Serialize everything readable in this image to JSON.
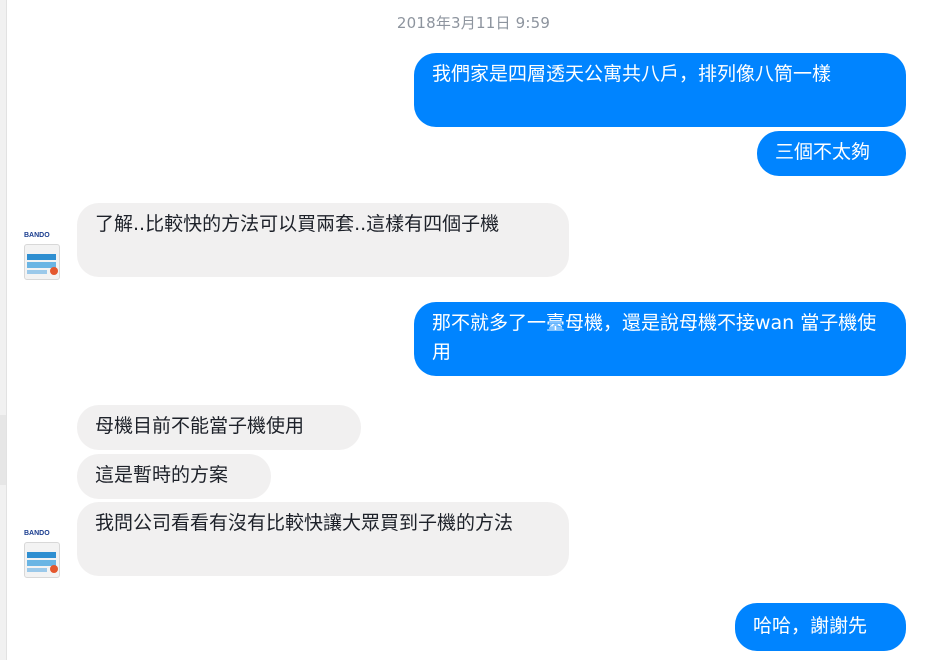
{
  "timestamp": "2018年3月11日 9:59",
  "avatar": {
    "brand_text": "BANDO",
    "icon": "bando-router-product-image"
  },
  "messages": [
    {
      "side": "outgoing",
      "text": "我們家是四層透天公寓共八戶，排列像八筒一樣"
    },
    {
      "side": "outgoing",
      "text": "三個不太夠"
    },
    {
      "side": "incoming",
      "text": "了解..比較快的方法可以買兩套..這樣有四個子機"
    },
    {
      "side": "outgoing",
      "text": "那不就多了一臺母機，還是說母機不接wan 當子機使用"
    },
    {
      "side": "incoming",
      "text": "母機目前不能當子機使用"
    },
    {
      "side": "incoming",
      "text": "這是暫時的方案"
    },
    {
      "side": "incoming",
      "text": "我問公司看看有沒有比較快讓大眾買到子機的方法"
    },
    {
      "side": "outgoing",
      "text": "哈哈，謝謝先"
    }
  ],
  "colors": {
    "outgoing_bubble": "#0084ff",
    "incoming_bubble": "#f1f0f0",
    "timestamp": "#8d949e"
  }
}
